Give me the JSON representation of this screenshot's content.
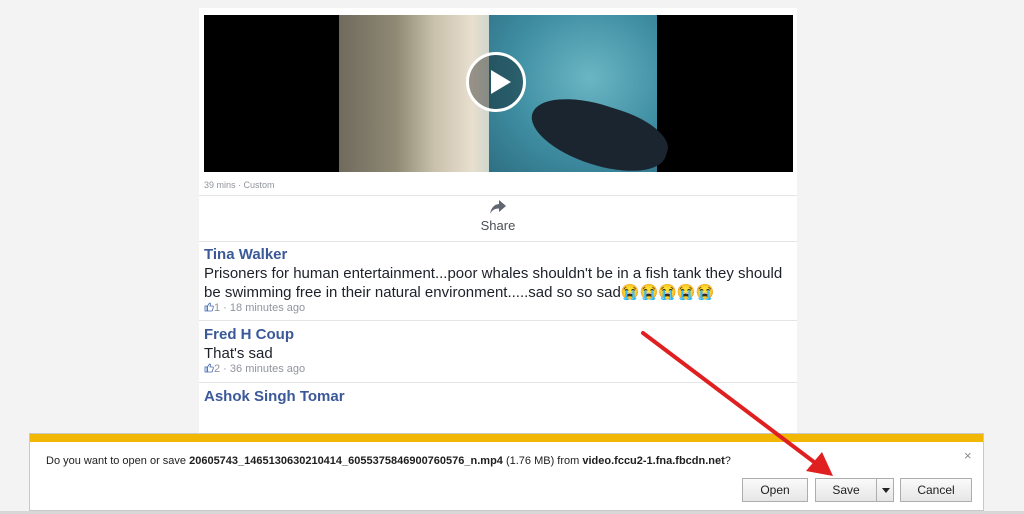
{
  "post": {
    "meta": "39 mins · Custom",
    "share_label": "Share"
  },
  "comments": [
    {
      "name": "Tina Walker",
      "text": "Prisoners for human entertainment...poor whales shouldn't be in a fish tank they should be swimming free in their natural environment.....sad so so sad😭😭😭😭😭",
      "likes": "1",
      "time": "18 minutes ago"
    },
    {
      "name": "Fred H Coup",
      "text": "That's sad",
      "likes": "2",
      "time": "36 minutes ago"
    },
    {
      "name": "Ashok Singh Tomar"
    }
  ],
  "download_bar": {
    "prefix": "Do you want to open or save ",
    "filename": "20605743_1465130630210414_6055375846900760576_n.mp4",
    "size": " (1.76 MB) from ",
    "source": "video.fccu2-1.fna.fbcdn.net",
    "suffix": "?",
    "close": "×",
    "open_label": "Open",
    "save_label": "Save",
    "cancel_label": "Cancel"
  },
  "colors": {
    "link": "#3b5998",
    "warning_stripe": "#f2b705",
    "annotation_arrow": "#e02020"
  }
}
